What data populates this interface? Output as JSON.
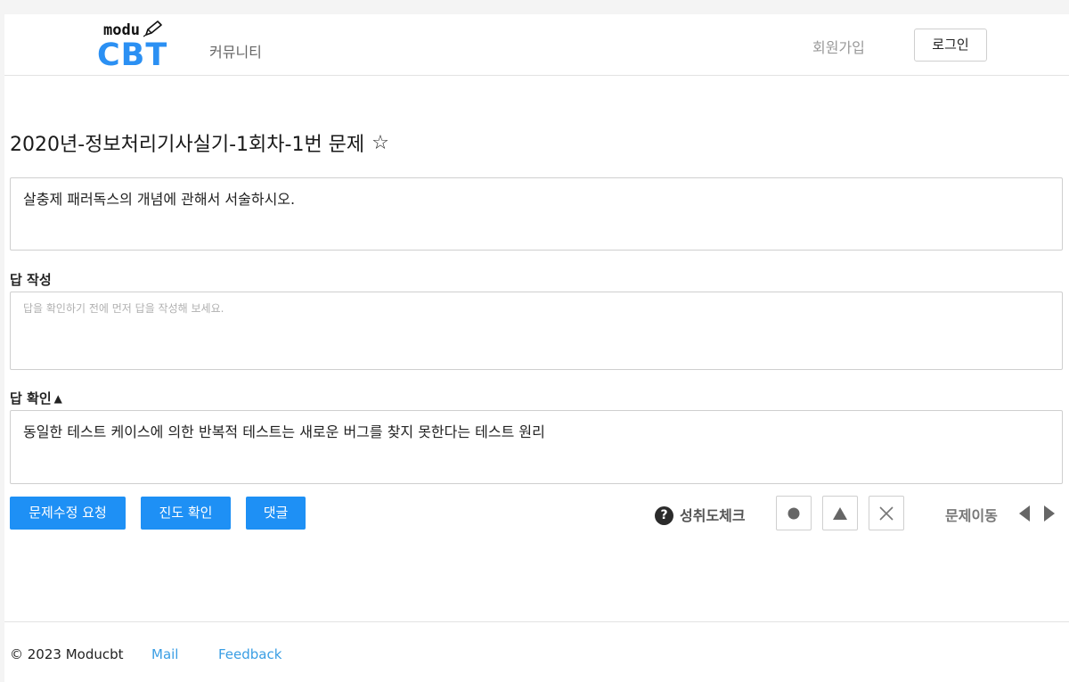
{
  "header": {
    "logo_top": "modu",
    "logo_main": "CBT",
    "nav_community": "커뮤니티",
    "signup": "회원가입",
    "login": "로그인"
  },
  "question": {
    "title": "2020년-정보처리기사실기-1회차-1번 문제",
    "favorite_icon": "☆",
    "text": "살충제 패러독스의 개념에 관해서 서술하시오."
  },
  "answer": {
    "label": "답 작성",
    "placeholder": "답을 확인하기 전에 먼저 답을 작성해 보세요."
  },
  "solution": {
    "label": "답 확인",
    "toggle_icon": "▲",
    "text": "동일한 테스트 케이스에 의한 반복적 테스트는 새로운 버그를 찾지 못한다는 테스트 원리"
  },
  "actions": {
    "edit_request": "문제수정 요청",
    "progress": "진도 확인",
    "comment": "댓글",
    "help_icon": "?",
    "achievement_label": "성취도체크",
    "move_label": "문제이동"
  },
  "footer": {
    "copyright": "© 2023 Moducbt",
    "mail": "Mail",
    "feedback": "Feedback"
  },
  "colors": {
    "brand": "#2b90f3",
    "button": "#1e90f5",
    "link": "#3a9ee4"
  }
}
